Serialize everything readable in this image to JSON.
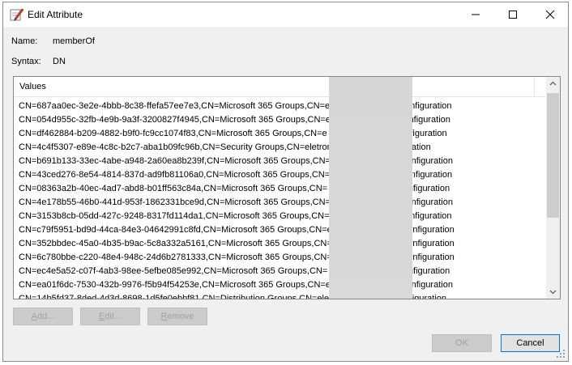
{
  "window": {
    "title": "Edit Attribute"
  },
  "fields": {
    "name_label": "Name:",
    "name_value": "memberOf",
    "syntax_label": "Syntax:",
    "syntax_value": "DN"
  },
  "list": {
    "header": "Values",
    "rows": [
      "CN=687aa0ec-3e2e-4bbb-8c38-ffefa57ee7e3,CN=Microsoft 365 Groups,CN=el                              ,CN=Azure,CN=Configuration",
      "CN=054d955c-32fb-4e9b-9a3f-3200827f4945,CN=Microsoft 365 Groups,CN=e                              ,CN=Azure,CN=Configuration",
      "CN=df462884-b209-4882-b9f0-fc9cc1074f83,CN=Microsoft 365 Groups,CN=e                              ,CN=Azure,CN=Configuration",
      "CN=4c4f5307-e89e-4c8c-b2c7-aba1b09fc96b,CN=Security Groups,CN=eletron                              Azure,CN=Configuration",
      "CN=b691b133-33ec-4abe-a948-2a60ea8b239f,CN=Microsoft 365 Groups,CN=                              r,CN=Azure,CN=Configuration",
      "CN=43ced276-8e54-4814-837d-ad9fb81106a0,CN=Microsoft 365 Groups,CN=                              r,CN=Azure,CN=Configuration",
      "CN=08363a2b-40ec-4ad7-abd8-b01ff563c84a,CN=Microsoft 365 Groups,CN=                              r,CN=Azure,CN=Configuration",
      "CN=4e178b55-46b0-441d-953f-1862331bce9d,CN=Microsoft 365 Groups,CN=                              r,CN=Azure,CN=Configuration",
      "CN=3153b8cb-05dd-427c-9248-8317fd114da1,CN=Microsoft 365 Groups,CN=                              r,CN=Azure,CN=Configuration",
      "CN=c79f5951-bd9d-44ca-84e3-04642991c8fd,CN=Microsoft 365 Groups,CN=e                              r,CN=Azure,CN=Configuration",
      "CN=352bbdec-45a0-4b35-b9ac-5c8a332a5161,CN=Microsoft 365 Groups,CN=                              r,CN=Azure,CN=Configuration",
      "CN=6c780bbe-c220-48e4-948c-24d6b2781333,CN=Microsoft 365 Groups,CN=                              r,CN=Azure,CN=Configuration",
      "CN=ec4e5a52-c07f-4ab3-98ee-5efbe085e992,CN=Microsoft 365 Groups,CN=                              r,CN=Azure,CN=Configuration",
      "CN=ea01f6dc-7530-432b-9976-f5b94f54253e,CN=Microsoft 365 Groups,CN=e                              r,CN=Azure,CN=Configuration",
      "CN=14b5fd37-8ded-4d3d-8698-1d5fe0ebbf81,CN=Distribution Groups,CN=ele                              CN=Azure,CN=Configuration"
    ]
  },
  "buttons": {
    "add": "Add...",
    "edit": "Edit...",
    "remove": "Remove",
    "ok": "OK",
    "cancel": "Cancel"
  }
}
